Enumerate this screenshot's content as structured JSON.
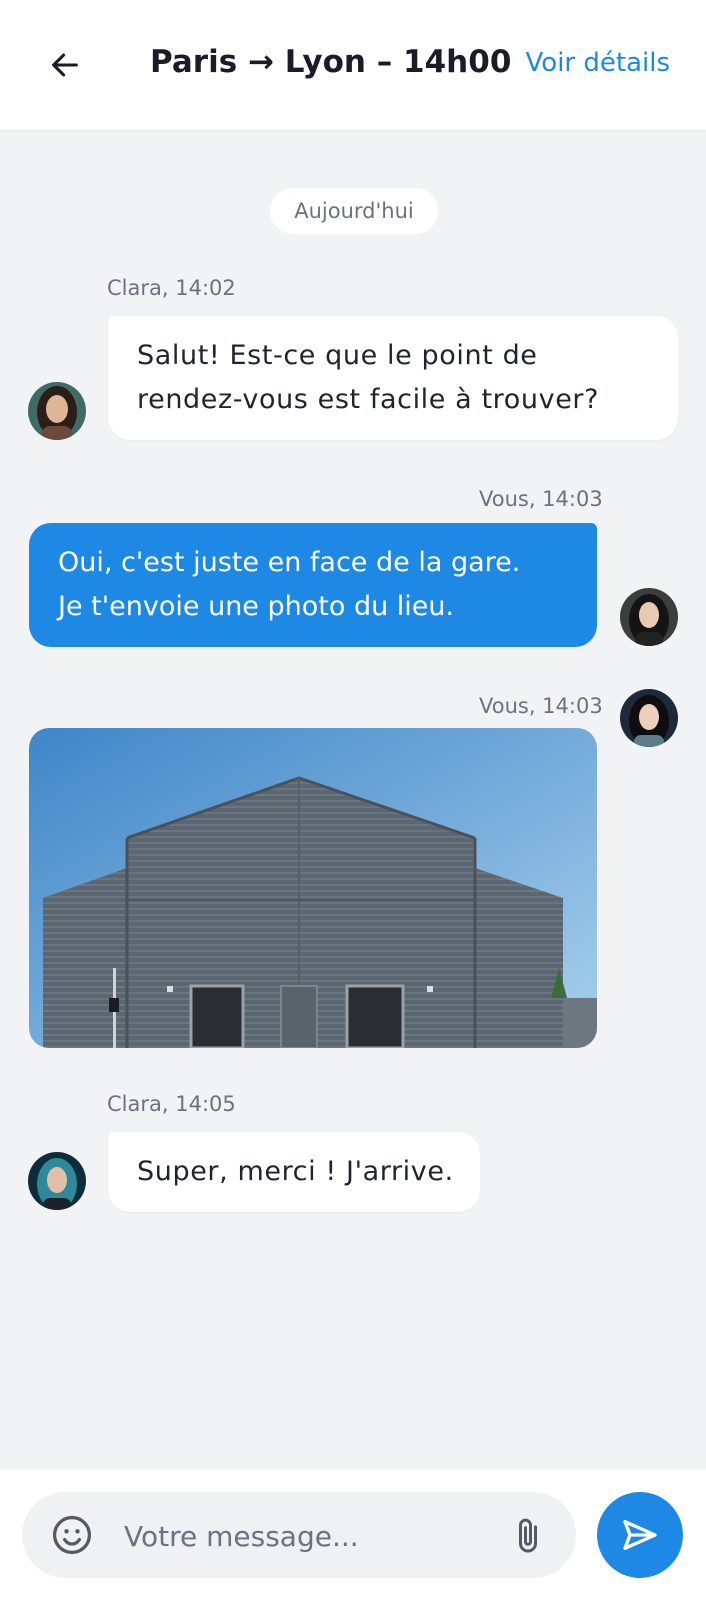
{
  "header": {
    "title": "Paris → Lyon – 14h00",
    "details_link": "Voir détails"
  },
  "day_separator": "Aujourd'hui",
  "messages": [
    {
      "sender": "Clara",
      "meta": "Clara, 14:02",
      "lines": [
        "Salut! Est-ce que le point de",
        "rendez-vous est facile à trouver?"
      ],
      "direction": "incoming"
    },
    {
      "sender": "Vous",
      "meta": "Vous, 14:03",
      "lines": [
        "Oui, c'est juste en face de la gare.",
        "Je t'envoie une photo du lieu."
      ],
      "direction": "outgoing"
    },
    {
      "sender": "Vous",
      "meta": "Vous, 14:03",
      "attachment": "photo",
      "direction": "outgoing"
    },
    {
      "sender": "Clara",
      "meta": "Clara, 14:05",
      "lines": [
        "Super, merci ! J'arrive."
      ],
      "direction": "incoming"
    }
  ],
  "composer": {
    "placeholder": "Votre message...",
    "emoji_icon": "smiley-icon",
    "attach_icon": "paperclip-icon",
    "send_icon": "send-icon"
  },
  "colors": {
    "accent": "#1e88e5",
    "background": "#f2f3f5",
    "incoming_bubble": "#ffffff",
    "text_primary": "#1a1d29",
    "text_muted": "#6b7280"
  }
}
